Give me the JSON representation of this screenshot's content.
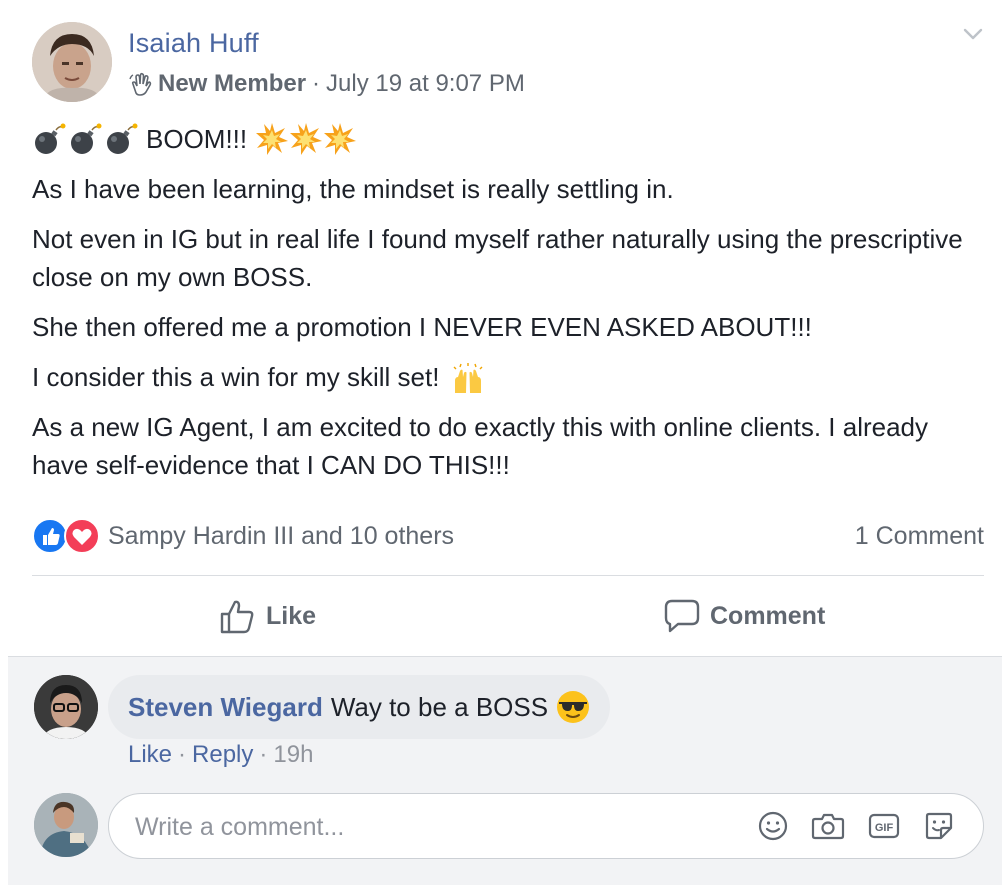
{
  "post": {
    "author": "Isaiah Huff",
    "badge": "New Member",
    "separator": "·",
    "timestamp": "July 19 at 9:07 PM",
    "boom_text": "BOOM!!!",
    "paragraphs": [
      "As I have been learning, the mindset is really settling in.",
      "Not even in IG but in real life I found myself rather naturally using the prescriptive close on my own BOSS.",
      "She then offered me a promotion I NEVER EVEN ASKED ABOUT!!!",
      "I consider this a win for my skill set!",
      "As a new IG Agent, I am excited to do exactly this with online clients. I already have self-evidence that I CAN DO THIS!!!"
    ]
  },
  "reactions": {
    "text": "Sampy Hardin III and 10 others",
    "comment_count": "1 Comment",
    "icons": [
      "like-reaction-icon",
      "love-reaction-icon"
    ]
  },
  "actions": {
    "like": "Like",
    "comment": "Comment"
  },
  "comment": {
    "author": "Steven Wiegard",
    "text": "Way to be a BOSS",
    "like": "Like",
    "reply": "Reply",
    "dot": "·",
    "time": "19h"
  },
  "composer": {
    "placeholder": "Write a comment..."
  },
  "colors": {
    "link": "#4b67a1",
    "muted": "#606770",
    "like_blue": "#1877f2",
    "love_red": "#f33e58"
  }
}
